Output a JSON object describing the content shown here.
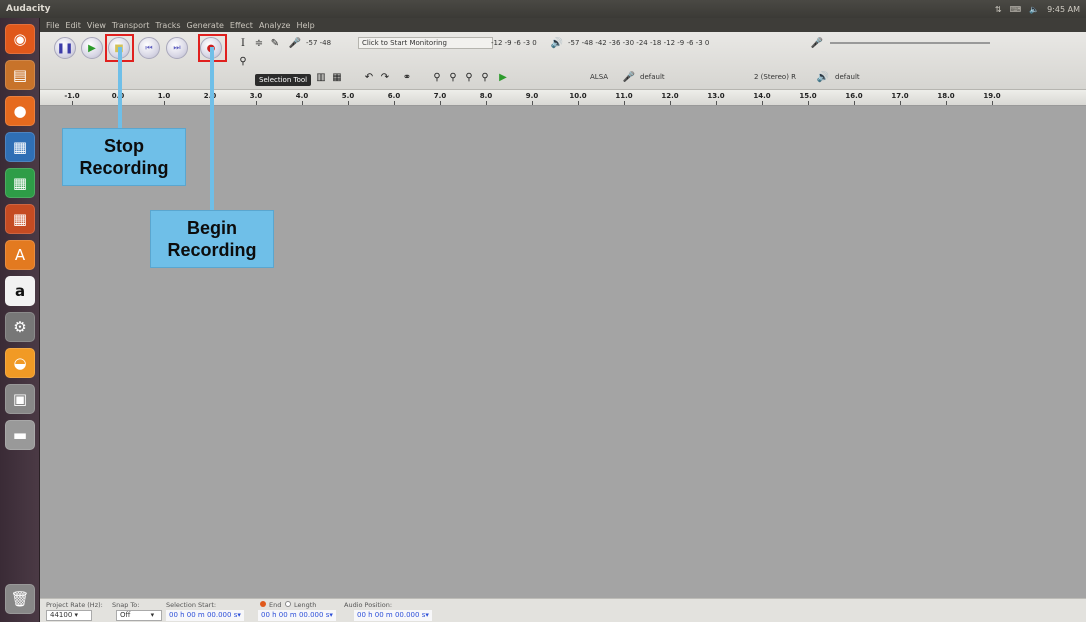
{
  "topbar": {
    "app_name": "Audacity",
    "clock": "9:45 AM"
  },
  "menu": [
    "File",
    "Edit",
    "View",
    "Transport",
    "Tracks",
    "Generate",
    "Effect",
    "Analyze",
    "Help"
  ],
  "meter": {
    "monitor_label": "Click to Start Monitoring",
    "rec_scale": "-57   -48",
    "rec_scale_right": "-12 -9 -6 -3 0",
    "play_scale": "-57      -48   -42   -36   -30   -24   -18   -12 -9 -6 -3 0"
  },
  "device": {
    "host": "ALSA",
    "rec_device": "default",
    "channels": "2 (Stereo) R",
    "play_device": "default"
  },
  "tooltip": "Selection Tool",
  "ruler": {
    "ticks": [
      "-1.0",
      "0.0",
      "1.0",
      "2.0",
      "3.0",
      "4.0",
      "5.0",
      "6.0",
      "7.0",
      "8.0",
      "9.0",
      "10.0",
      "11.0",
      "12.0",
      "13.0",
      "14.0",
      "15.0",
      "16.0",
      "17.0",
      "18.0",
      "19.0"
    ]
  },
  "selection_bar": {
    "project_rate_label": "Project Rate (Hz):",
    "project_rate": "44100",
    "snap_label": "Snap To:",
    "snap_value": "Off",
    "selection_start_label": "Selection Start:",
    "end_label": "End",
    "length_label": "Length",
    "audio_position_label": "Audio Position:",
    "start_time": "00 h 00 m 00.000 s",
    "end_time": "00 h 00 m 00.000 s",
    "audio_time": "00 h 00 m 00.000 s"
  },
  "callouts": {
    "stop": [
      "Stop",
      "Recording"
    ],
    "begin": [
      "Begin",
      "Recording"
    ],
    "color": "#6fbfe8"
  },
  "colors": {
    "highlight": "#e0201e",
    "track_bg": "#a4a4a4",
    "record": "#cc1f1f"
  }
}
